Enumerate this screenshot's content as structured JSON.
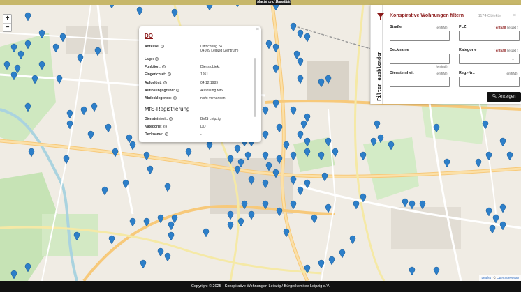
{
  "header": {
    "logo_text": "Macht und Banalität"
  },
  "map": {
    "zoom_in": "+",
    "zoom_out": "−"
  },
  "popup": {
    "close": "×",
    "title": "DO",
    "rows": [
      {
        "label": "Adresse:",
        "value": "Dittrichring 24",
        "value2": "04109 Leipzig (Zentrum)"
      },
      {
        "label": "Lage:",
        "value": "-"
      },
      {
        "label": "Funktion:",
        "value": "Dienstobjekt"
      },
      {
        "label": "Eingerichtet:",
        "value": "1951"
      },
      {
        "label": "Aufgelöst:",
        "value": "04.12.1989"
      },
      {
        "label": "Auflösungsgrund:",
        "value": "Auflösung MfS"
      },
      {
        "label": "Abdecklegende:",
        "value": "nicht vorhanden"
      },
      {
        "label": "Diensteinheit:",
        "value": "BVfS Leipzig"
      },
      {
        "label": "Kategorie:",
        "value": "DO"
      },
      {
        "label": "Deckname:",
        "value": "-"
      }
    ],
    "section": "MfS-Registrierung",
    "help": "?"
  },
  "filter": {
    "toggle": "Filter ausblenden",
    "title": "Konspirative Wohnungen filtern",
    "count": "1174 Objekte",
    "close": "×",
    "fields": {
      "strasse": {
        "label": "Straße",
        "hint": "(enthält)"
      },
      "plz": {
        "label": "PLZ",
        "hint_a": "( enthält",
        "hint_b": " | exakt )"
      },
      "deckname": {
        "label": "Deckname",
        "hint": "(enthält)"
      },
      "kategorie": {
        "label": "Kategorie",
        "hint_a": "( enthält",
        "hint_b": " | exakt )"
      },
      "diensteinheit": {
        "label": "Diensteinheit",
        "hint": "(enthält)"
      },
      "regnr": {
        "label": "Reg.-Nr.:",
        "hint": "(enthält)"
      }
    },
    "submit": "Anzeigen"
  },
  "attribution": {
    "leaflet": "Leaflet",
    "sep": " | © ",
    "osm": "OpenStreetMap"
  },
  "footer": {
    "text": "Copyright © 2025 - Konspirative Wohnungen Leipzig / Bürgerkomitee Leipzig e.V."
  },
  "colors": {
    "accent": "#8b1a1a",
    "marker": "#2d7fc9",
    "topbar": "#c7b76a"
  }
}
